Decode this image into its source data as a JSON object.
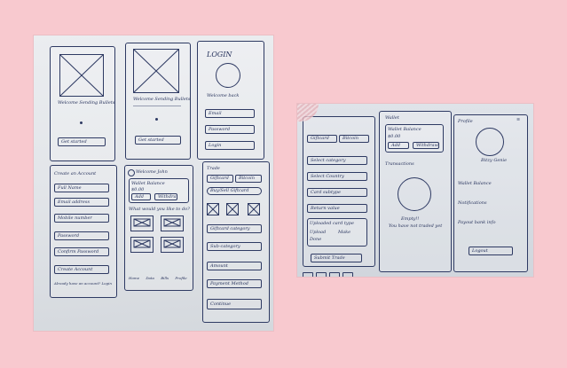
{
  "left_photo": {
    "s1": {
      "caption": "Welcome Sending Bullets",
      "button": "Get started"
    },
    "s2": {
      "caption": "Welcome Sending Bullets",
      "button": "Get started"
    },
    "s3": {
      "title": "LOGIN",
      "subtitle": "Welcome back",
      "email": "Email",
      "password": "Password",
      "button": "Login"
    },
    "s4": {
      "title": "Create an Account",
      "full_name": "Full Name",
      "email": "Email address",
      "mobile": "Mobile number",
      "password": "Password",
      "confirm": "Confirm Password",
      "button": "Create Account",
      "footer": "Already have an account? Login"
    },
    "s5": {
      "header": "Welcome John",
      "wallet_label": "Wallet Balance",
      "wallet_value": "$0.00",
      "add_button": "Add",
      "withdraw_button": "Withdraw",
      "question": "What would you like to do?",
      "nav": [
        "Home",
        "Data",
        "Bills",
        "Profile"
      ]
    },
    "s6": {
      "title": "Trade",
      "tabs": [
        "Giftcard",
        "Bitcoin"
      ],
      "trade_button": "Buy/Sell Giftcard",
      "giftcard_select": "Giftcard category",
      "subcategory_select": "Sub-category",
      "amount_field": "Amount",
      "payment_field": "Payment Method",
      "button": "Continue"
    }
  },
  "right_photo": {
    "r1": {
      "tabs": [
        "Giftcard",
        "Bitcoin"
      ],
      "fields": [
        "Select category",
        "Select Country",
        "Card subtype",
        "Return value"
      ],
      "note_lines": [
        "Uploaded card type",
        "Upload",
        "Make",
        "Done"
      ],
      "button": "Submit Trade"
    },
    "r2": {
      "title": "Wallet",
      "wallet_label": "Wallet Balance",
      "wallet_value": "$0.00",
      "buttons": [
        "Add",
        "Withdraw"
      ],
      "section": "Transactions",
      "empty_title": "Empty!!",
      "empty_text": "You have not traded yet"
    },
    "r3": {
      "title": "Profile",
      "profile_name": "Bitzy Genie",
      "fields": [
        "Wallet Balance",
        "Notifications",
        "Payout bank info"
      ],
      "button": "Logout"
    }
  }
}
